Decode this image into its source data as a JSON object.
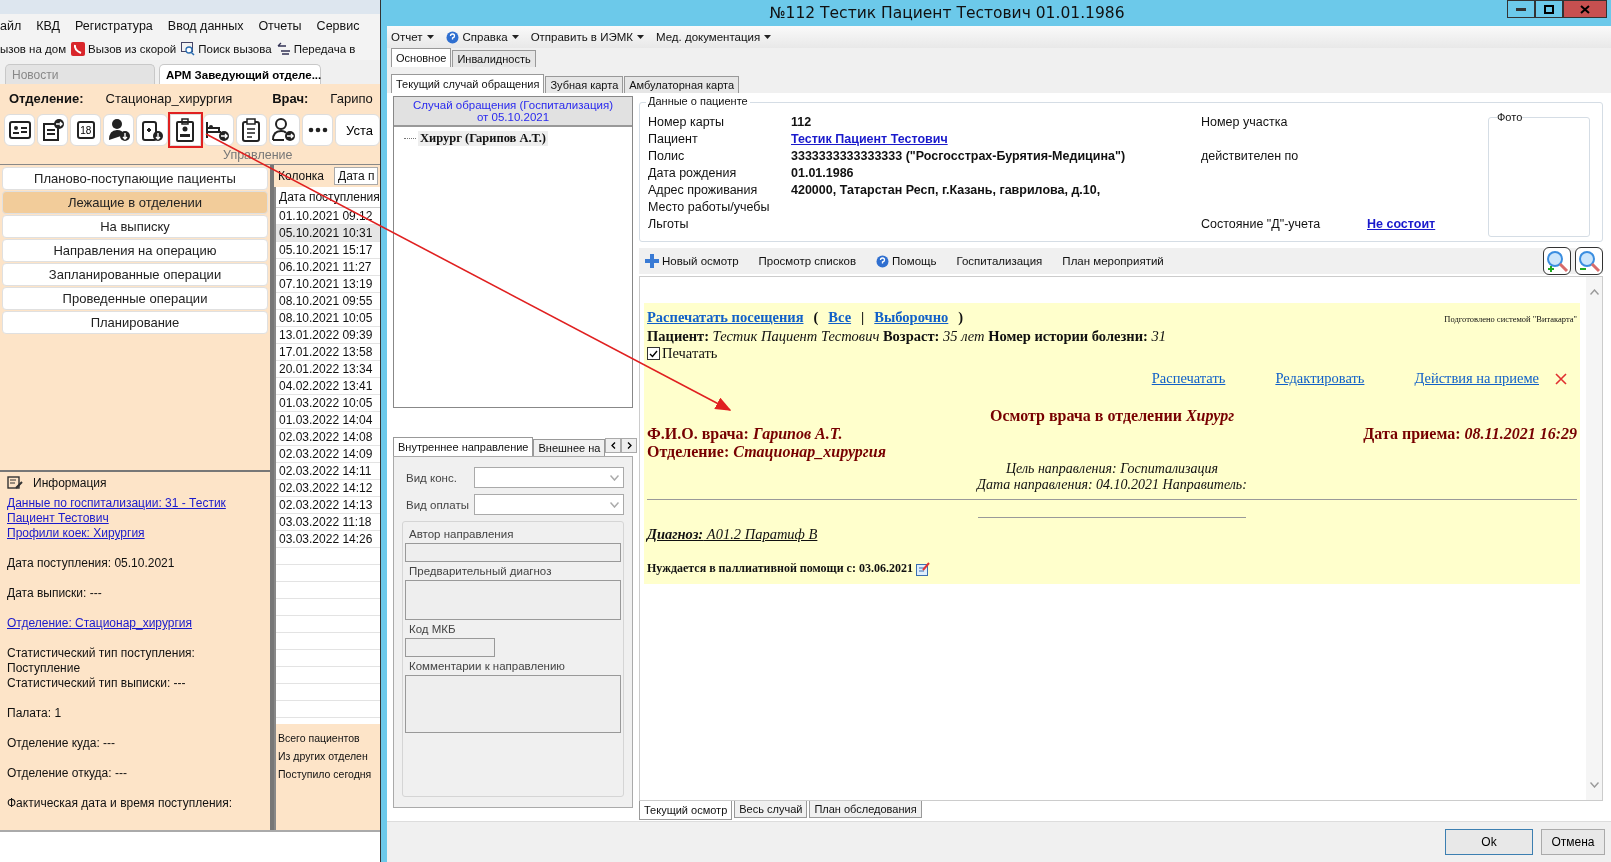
{
  "background_app": {
    "menu": [
      "айл",
      "КВД",
      "Регистратура",
      "Ввод данных",
      "Отчеты",
      "Сервис"
    ],
    "toolbar": [
      {
        "label": "ызов на дом",
        "kind": "plain"
      },
      {
        "label": "Вызов из скорой",
        "kind": "phone"
      },
      {
        "label": "Поиск вызова",
        "kind": "search"
      },
      {
        "label": "Передача в",
        "kind": "transfer"
      }
    ],
    "tabs": [
      {
        "label": "Новости",
        "selected": false
      },
      {
        "label": "АРМ Заведующий отделе...",
        "selected": true
      }
    ],
    "department_label": "Отделение:",
    "department": "Стационар_хирургия",
    "doctor_label": "Врач:",
    "doctor": "Гарипо",
    "action_icons": [
      {
        "kind": "card",
        "highlighted": false
      },
      {
        "kind": "document",
        "highlighted": false
      },
      {
        "kind": "calendar",
        "label": "18",
        "highlighted": false
      },
      {
        "kind": "person",
        "highlighted": false
      },
      {
        "kind": "clipboard-down",
        "highlighted": false
      },
      {
        "kind": "badge",
        "highlighted": true
      },
      {
        "kind": "bed",
        "highlighted": false
      },
      {
        "kind": "clipboard",
        "highlighted": false
      },
      {
        "kind": "person-arrow",
        "highlighted": false
      },
      {
        "kind": "more",
        "highlighted": false
      }
    ],
    "settings_button": "Уста",
    "group_label": "Управление",
    "nav": [
      {
        "label": "Планово-поступающие пациенты",
        "selected": false
      },
      {
        "label": "Лежащие в отделении",
        "selected": true
      },
      {
        "label": "На выписку",
        "selected": false
      },
      {
        "label": "Направления на операцию",
        "selected": false
      },
      {
        "label": "Запланированные операции",
        "selected": false
      },
      {
        "label": "Проведенные операции",
        "selected": false
      },
      {
        "label": "Планирование",
        "selected": false
      }
    ],
    "column_label": "Колонка",
    "column_value": "Дата п",
    "table": {
      "header": "Дата поступления",
      "rows": [
        {
          "value": "01.10.2021 09:12",
          "selected": false
        },
        {
          "value": "05.10.2021 10:31",
          "selected": true
        },
        {
          "value": "05.10.2021 15:17",
          "selected": false
        },
        {
          "value": "06.10.2021 11:27",
          "selected": false
        },
        {
          "value": "07.10.2021 13:19",
          "selected": false
        },
        {
          "value": "08.10.2021 09:55",
          "selected": false
        },
        {
          "value": "08.10.2021 10:05",
          "selected": false
        },
        {
          "value": "13.01.2022 09:39",
          "selected": false
        },
        {
          "value": "17.01.2022 13:58",
          "selected": false
        },
        {
          "value": "20.01.2022 13:34",
          "selected": false
        },
        {
          "value": "04.02.2022 13:41",
          "selected": false
        },
        {
          "value": "01.03.2022 10:05",
          "selected": false
        },
        {
          "value": "01.03.2022 14:04",
          "selected": false
        },
        {
          "value": "02.03.2022 14:08",
          "selected": false
        },
        {
          "value": "02.03.2022 14:09",
          "selected": false
        },
        {
          "value": "02.03.2022 14:11",
          "selected": false
        },
        {
          "value": "02.03.2022 14:12",
          "selected": false
        },
        {
          "value": "02.03.2022 14:13",
          "selected": false
        },
        {
          "value": "03.03.2022 11:18",
          "selected": false
        },
        {
          "value": "03.03.2022 14:26",
          "selected": false
        }
      ]
    },
    "info": {
      "title": "Информация",
      "paragraphs": [
        [
          {
            "text": "Данные по госпитализации: 31 - Тестик Пациент Тестович",
            "link": true
          },
          {
            "text": "Профили коек: Хирургия",
            "link": true
          }
        ],
        [
          {
            "text": "Дата поступления: 05.10.2021",
            "link": false
          }
        ],
        [
          {
            "text": "Дата выписки: ---",
            "link": false
          }
        ],
        [
          {
            "text": "Отделение: Стационар_хирургия",
            "link": true
          }
        ],
        [
          {
            "text": "Статистический тип поступления: Поступление",
            "link": false
          },
          {
            "text": "Статистический тип выписки: ---",
            "link": false
          }
        ],
        [
          {
            "text": "Палата: 1",
            "link": false
          }
        ],
        [
          {
            "text": "Отделение куда: ---",
            "link": false
          }
        ],
        [
          {
            "text": "Отделение откуда: ---",
            "link": false
          }
        ],
        [
          {
            "text": "Фактическая дата и время поступления:",
            "link": false
          }
        ]
      ]
    },
    "stats": [
      "Всего пациентов",
      "Из других отделен",
      "Поступило сегодня"
    ]
  },
  "window": {
    "title": "№112 Тестик Пациент Тестович 01.01.1986",
    "menu": [
      {
        "label": "Отчет",
        "kind": "plain"
      },
      {
        "label": "Справка",
        "kind": "help"
      },
      {
        "label": "Отправить в ИЭМК",
        "kind": "plain"
      },
      {
        "label": "Мед. документация",
        "kind": "plain"
      }
    ],
    "tabs": [
      {
        "label": "Основное",
        "selected": true
      },
      {
        "label": "Инвалидность",
        "selected": false
      }
    ],
    "subtabs": [
      {
        "label": "Текущий случай обращения",
        "selected": true
      },
      {
        "label": "Зубная карта",
        "selected": false
      },
      {
        "label": "Амбулаторная карта",
        "selected": false
      }
    ],
    "case": {
      "header": [
        "Случай обращения (Госпитализация)",
        "от 05.10.2021"
      ],
      "tree": [
        {
          "label": "Хирург (Гарипов А.Т.)",
          "selected": true
        }
      ]
    },
    "referral": {
      "tabs": [
        {
          "label": "Внутреннее направление",
          "selected": true
        },
        {
          "label": "Внешнее на",
          "selected": false
        }
      ],
      "selects": [
        "Вид конс.",
        "Вид оплаты"
      ],
      "fields": [
        {
          "label": "Автор направления",
          "kind": "input"
        },
        {
          "label": "Предварительный диагноз",
          "kind": "textarea"
        },
        {
          "label": "Код МКБ",
          "kind": "short"
        },
        {
          "label": "Комментарии к направлению",
          "kind": "textarea"
        }
      ]
    },
    "patient": {
      "title": "Данные о пациенте",
      "photo_label": "Фото",
      "rows": [
        {
          "label": "Номер карты",
          "value": "112",
          "value_link": false,
          "side_label": "Номер участка"
        },
        {
          "label": "Пациент",
          "value": "Тестик Пациент Тестович",
          "value_link": true
        },
        {
          "label": "Полис",
          "value": "3333333333333333 (\"Росгосстрах-Бурятия-Медицина\")",
          "value_link": false,
          "side_label": "действителен по"
        },
        {
          "label": "Дата рождения",
          "value": "01.01.1986",
          "value_link": false
        },
        {
          "label": "Адрес проживания",
          "value": "420000, Татарстан Респ, г.Казань, гаврилова, д.10,",
          "value_link": false
        },
        {
          "label": "Место работы/учебы"
        },
        {
          "label": "Льготы",
          "side_label": "Состояние \"Д\"-учета",
          "side_value": "Не состоит"
        }
      ]
    },
    "toolbar": [
      {
        "label": "Новый осмотр",
        "kind": "plus"
      },
      {
        "label": "Просмотр списков",
        "kind": "plain"
      },
      {
        "label": "Помощь",
        "kind": "help"
      },
      {
        "label": "Госпитализация",
        "kind": "plain"
      },
      {
        "label": "План мероприятий",
        "kind": "plain"
      }
    ],
    "report": {
      "print_link": "Распечатать посещения",
      "open_paren": "(",
      "all": "Все",
      "separator": "|",
      "selective": "Выборочно",
      "close_paren": ")",
      "credit": "Подготовлено системой \"Витакарта\"",
      "patient_line": "**Пациент:** *Тестик Пациент Тестович* **Возраст:** *35 лет* **Номер истории болезни:** *31*",
      "print_checkbox": {
        "label": "Печатать",
        "checked": true
      },
      "actions": [
        "Распечатать",
        "Редактировать",
        "Действия на приеме"
      ],
      "heading": "Осмотр врача в отделении *Хирург*",
      "doctor_line": "Ф.И.О. врача: *Гарипов А.Т.*",
      "date_line": "Дата приема: *08.11.2021 16:29*",
      "department_line": "Отделение: *Стационар_хирургия*",
      "purpose": "Цель направления: Госпитализация",
      "referral_date": "Дата направления: 04.10.2021 Направитель:",
      "diagnosis": "**Диагноз:** A01.2 Паратиф В",
      "palliative": "Нуждается в паллиативной помощи с: 03.06.2021"
    },
    "bottom_tabs": [
      {
        "label": "Текущий осмотр",
        "selected": true
      },
      {
        "label": "Весь случай",
        "selected": false
      },
      {
        "label": "План обследования",
        "selected": false
      }
    ],
    "buttons": [
      "Ok",
      "Отмена"
    ]
  }
}
